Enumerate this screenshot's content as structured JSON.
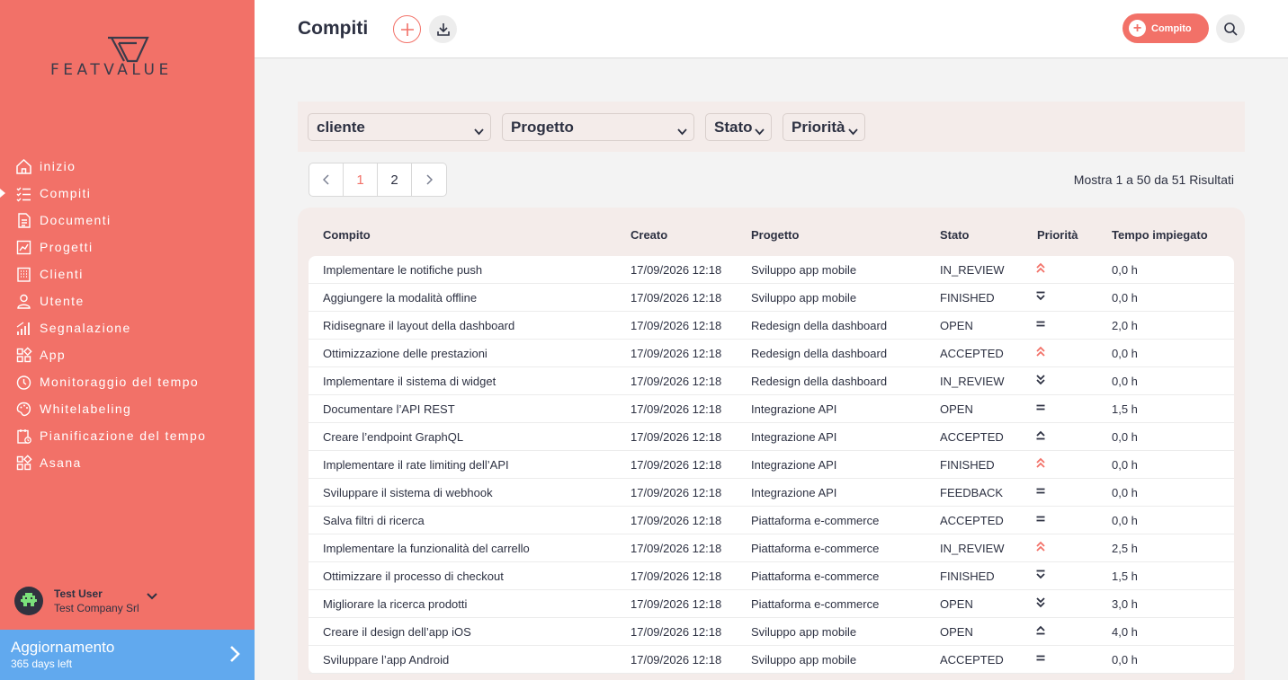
{
  "sidebar": {
    "logo_text": "FEATVALUE",
    "items": [
      {
        "label": "inizio",
        "icon": "home-icon",
        "active": false
      },
      {
        "label": "Compiti",
        "icon": "task-list-icon",
        "active": true
      },
      {
        "label": "Documenti",
        "icon": "document-icon",
        "active": false
      },
      {
        "label": "Progetti",
        "icon": "chart-icon",
        "active": false
      },
      {
        "label": "Clienti",
        "icon": "building-icon",
        "active": false
      },
      {
        "label": "Utente",
        "icon": "user-icon",
        "active": false
      },
      {
        "label": "Segnalazione",
        "icon": "report-bars-icon",
        "active": false
      },
      {
        "label": "App",
        "icon": "apps-grid-icon",
        "active": false
      },
      {
        "label": "Monitoraggio del tempo",
        "icon": "clock-icon",
        "active": false
      },
      {
        "label": "Whitelabeling",
        "icon": "palette-icon",
        "active": false
      },
      {
        "label": "Pianificazione del tempo",
        "icon": "calendar-clipboard-icon",
        "active": false
      },
      {
        "label": "Asana",
        "icon": "apps-grid-icon",
        "active": false
      }
    ],
    "user": {
      "name": "Test User",
      "company": "Test Company Srl"
    },
    "upgrade": {
      "title": "Aggiornamento",
      "subtitle": "365 days left"
    }
  },
  "header": {
    "title": "Compiti",
    "new_task_label": "Compito"
  },
  "filters": {
    "cliente": "cliente",
    "progetto": "Progetto",
    "stato": "Stato",
    "priorita": "Priorità"
  },
  "pagination": {
    "pages": [
      "1",
      "2"
    ],
    "current": "1",
    "results_text": "Mostra 1 a 50 da 51 Risultati"
  },
  "table": {
    "headers": {
      "compito": "Compito",
      "creato": "Creato",
      "progetto": "Progetto",
      "stato": "Stato",
      "priorita": "Priorità",
      "tempo": "Tempo impiegato"
    },
    "rows": [
      {
        "task": "Implementare le notifiche push",
        "created": "17/09/2026 12:18",
        "project": "Sviluppo app mobile",
        "status": "IN_REVIEW",
        "priority": "highest",
        "time": "0,0 h"
      },
      {
        "task": "Aggiungere la modalità offline",
        "created": "17/09/2026 12:18",
        "project": "Sviluppo app mobile",
        "status": "FINISHED",
        "priority": "low",
        "time": "0,0 h"
      },
      {
        "task": "Ridisegnare il layout della dashboard",
        "created": "17/09/2026 12:18",
        "project": "Redesign della dashboard",
        "status": "OPEN",
        "priority": "medium",
        "time": "2,0 h"
      },
      {
        "task": "Ottimizzazione delle prestazioni",
        "created": "17/09/2026 12:18",
        "project": "Redesign della dashboard",
        "status": "ACCEPTED",
        "priority": "highest",
        "time": "0,0 h"
      },
      {
        "task": "Implementare il sistema di widget",
        "created": "17/09/2026 12:18",
        "project": "Redesign della dashboard",
        "status": "IN_REVIEW",
        "priority": "lowest",
        "time": "0,0 h"
      },
      {
        "task": "Documentare l’API REST",
        "created": "17/09/2026 12:18",
        "project": "Integrazione API",
        "status": "OPEN",
        "priority": "medium",
        "time": "1,5 h"
      },
      {
        "task": "Creare l’endpoint GraphQL",
        "created": "17/09/2026 12:18",
        "project": "Integrazione API",
        "status": "ACCEPTED",
        "priority": "high",
        "time": "0,0 h"
      },
      {
        "task": "Implementare il rate limiting dell’API",
        "created": "17/09/2026 12:18",
        "project": "Integrazione API",
        "status": "FINISHED",
        "priority": "highest",
        "time": "0,0 h"
      },
      {
        "task": "Sviluppare il sistema di webhook",
        "created": "17/09/2026 12:18",
        "project": "Integrazione API",
        "status": "FEEDBACK",
        "priority": "medium",
        "time": "0,0 h"
      },
      {
        "task": "Salva filtri di ricerca",
        "created": "17/09/2026 12:18",
        "project": "Piattaforma e-commerce",
        "status": "ACCEPTED",
        "priority": "medium",
        "time": "0,0 h"
      },
      {
        "task": "Implementare la funzionalità del carrello",
        "created": "17/09/2026 12:18",
        "project": "Piattaforma e-commerce",
        "status": "IN_REVIEW",
        "priority": "highest",
        "time": "2,5 h"
      },
      {
        "task": "Ottimizzare il processo di checkout",
        "created": "17/09/2026 12:18",
        "project": "Piattaforma e-commerce",
        "status": "FINISHED",
        "priority": "low",
        "time": "1,5 h"
      },
      {
        "task": "Migliorare la ricerca prodotti",
        "created": "17/09/2026 12:18",
        "project": "Piattaforma e-commerce",
        "status": "OPEN",
        "priority": "lowest",
        "time": "3,0 h"
      },
      {
        "task": "Creare il design dell’app iOS",
        "created": "17/09/2026 12:18",
        "project": "Sviluppo app mobile",
        "status": "OPEN",
        "priority": "high",
        "time": "4,0 h"
      },
      {
        "task": "Sviluppare l’app Android",
        "created": "17/09/2026 12:18",
        "project": "Sviluppo app mobile",
        "status": "ACCEPTED",
        "priority": "medium",
        "time": "0,0 h"
      }
    ]
  },
  "colors": {
    "brand": "#f27168",
    "upgrade": "#61a9ee",
    "text": "#2d3142"
  }
}
